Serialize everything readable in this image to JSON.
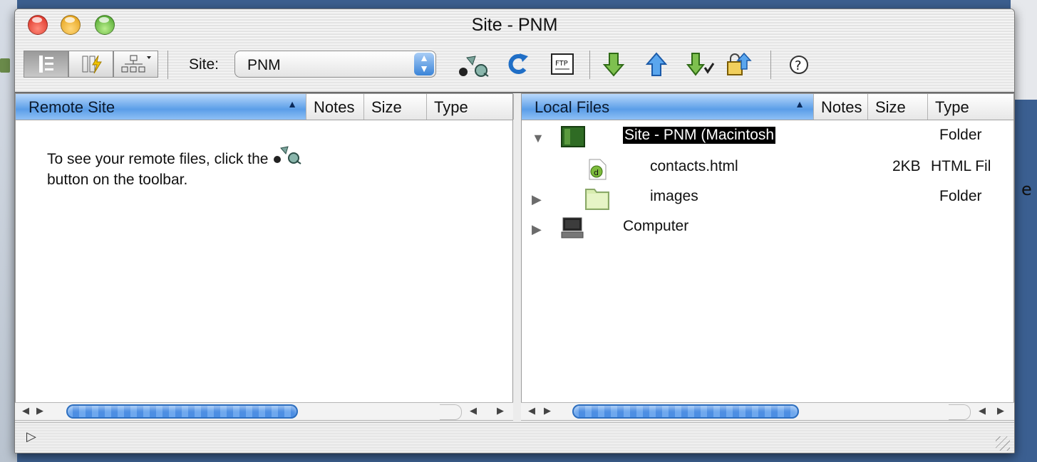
{
  "window": {
    "title": "Site - PNM"
  },
  "toolbar": {
    "site_label": "Site:",
    "site_value": "PNM",
    "buttons": [
      "site-files-view",
      "testing-server-view",
      "site-map-view",
      "connect",
      "refresh",
      "ftp-log",
      "get",
      "put",
      "check-out",
      "check-in",
      "help"
    ]
  },
  "remote": {
    "headers": {
      "name": "Remote Site",
      "notes": "Notes",
      "size": "Size",
      "type": "Type"
    },
    "hint_line1": "To see your remote files, click the",
    "hint_line2": "button on the toolbar."
  },
  "local": {
    "headers": {
      "name": "Local Files",
      "notes": "Notes",
      "size": "Size",
      "type": "Type"
    },
    "rows": [
      {
        "name": "Site - PNM (Macintosh",
        "size": "",
        "type": "Folder",
        "icon": "site-folder-icon",
        "expanded": true
      },
      {
        "name": "contacts.html",
        "size": "2KB",
        "type": "HTML Fil",
        "icon": "html-file-icon"
      },
      {
        "name": "images",
        "size": "",
        "type": "Folder",
        "icon": "folder-icon",
        "expanded": false
      },
      {
        "name": "Computer",
        "size": "",
        "type": "",
        "icon": "computer-icon",
        "expanded": false
      }
    ]
  },
  "colors": {
    "header_accent": "#5b9ee8",
    "scroll_thumb": "#4c8ee3",
    "selection": "#000000"
  },
  "desktop": {
    "edge_text": "e"
  }
}
